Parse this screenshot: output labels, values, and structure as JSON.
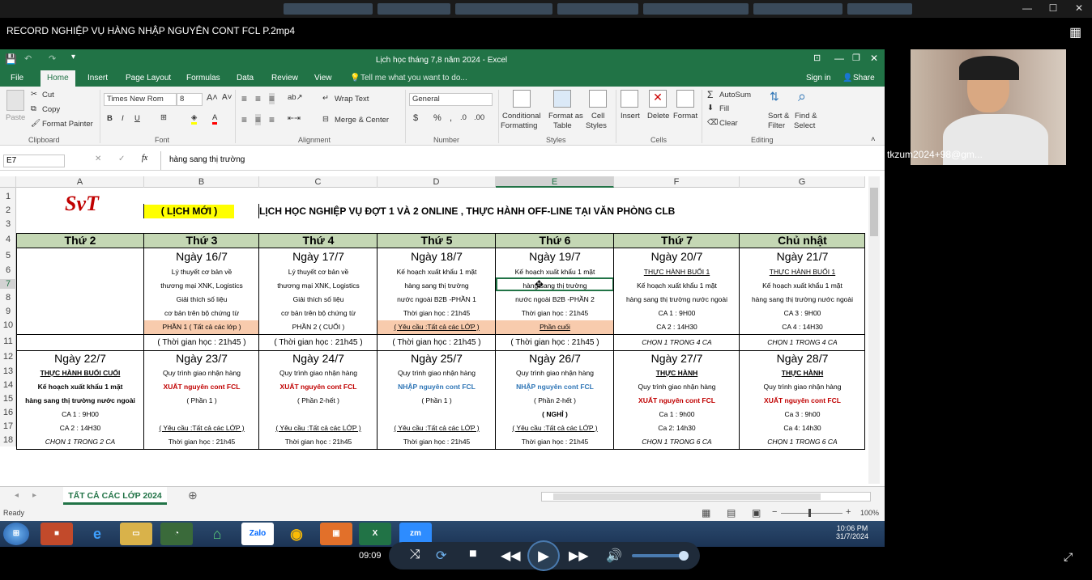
{
  "player": {
    "title": "RECORD NGHIỆP VỤ HÀNG NHẬP NGUYÊN CONT FCL P.2mp4",
    "time": "09:09"
  },
  "excel": {
    "title": "Lịch học tháng 7,8 năm  2024 - Excel",
    "tabs": [
      "File",
      "Home",
      "Insert",
      "Page Layout",
      "Formulas",
      "Data",
      "Review",
      "View"
    ],
    "tell_me": "Tell me what you want to do...",
    "sign_in": "Sign in",
    "share": "Share",
    "clipboard": {
      "paste": "Paste",
      "cut": "Cut",
      "copy": "Copy",
      "format_painter": "Format Painter",
      "label": "Clipboard"
    },
    "font": {
      "name": "Times New Rom",
      "size": "8",
      "label": "Font"
    },
    "alignment": {
      "wrap": "Wrap Text",
      "merge": "Merge & Center",
      "label": "Alignment"
    },
    "number": {
      "format": "General",
      "label": "Number"
    },
    "styles": {
      "conditional": "Conditional",
      "formatting": "Formatting",
      "format_as": "Format as",
      "table": "Table",
      "cell": "Cell",
      "cell_styles": "Styles",
      "label": "Styles"
    },
    "cells": {
      "insert": "Insert",
      "delete": "Delete",
      "format": "Format",
      "label": "Cells"
    },
    "editing": {
      "autosum": "AutoSum",
      "fill": "Fill",
      "clear": "Clear",
      "sort": "Sort &",
      "filter": "Filter",
      "find": "Find &",
      "select": "Select",
      "label": "Editing"
    },
    "name_box": "E7",
    "formula": "hàng sang thị trường",
    "columns": [
      "A",
      "B",
      "C",
      "D",
      "E",
      "F",
      "G"
    ],
    "rows": [
      "1",
      "2",
      "3",
      "4",
      "5",
      "6",
      "7",
      "8",
      "9",
      "10",
      "11",
      "12",
      "13",
      "14",
      "15",
      "16",
      "17",
      "18"
    ],
    "sheet_tab": "TẤT CẢ CÁC LỚP 2024",
    "status": "Ready",
    "zoom": "100%"
  },
  "sheet": {
    "logo": "SvT",
    "badge": "( LỊCH MỚI )",
    "heading": "LỊCH HỌC NGHIỆP VỤ  ĐỢT 1 VÀ 2  ONLINE ,  THỰC HÀNH  OFF-LINE TẠI  VĂN PHÒNG CLB",
    "days": [
      "Thứ 2",
      "Thứ 3",
      "Thứ 4",
      "Thứ 5",
      "Thứ 6",
      "Thứ 7",
      "Chủ nhật"
    ],
    "w1_dates": [
      "",
      "Ngày 16/7",
      "Ngày 17/7",
      "Ngày 18/7",
      "Ngày 19/7",
      "Ngày 20/7",
      "Ngày 21/7"
    ],
    "w1": [
      [
        "",
        "Lý thuyết cơ bản về",
        "Lý thuyết cơ bản về",
        "Kế hoạch xuất khẩu 1 mặt",
        "Kế hoạch xuất khẩu 1 mặt",
        "THỰC HÀNH  BUỔI 1",
        "THỰC HÀNH   BUỔI 1"
      ],
      [
        "",
        "thương mại XNK, Logistics",
        "thương mại XNK, Logistics",
        "hàng sang thị trường",
        "hàng sang thị trường",
        "Kế hoạch xuất khẩu 1 mặt",
        "Kế hoạch xuất khẩu 1 mặt"
      ],
      [
        "",
        "Giải thích số liệu",
        "Giải thích số liệu",
        "nước ngoài B2B -PHẦN 1",
        "nước ngoài B2B -PHẦN 2",
        "hàng sang thị trường nước ngoài",
        "hàng sang thị trường nước ngoài"
      ],
      [
        "",
        "cơ bản trên bộ chứng từ",
        "cơ bản trên bộ chứng từ",
        "Thời gian học : 21h45",
        "Thời gian học : 21h45",
        "CA 1 : 9H00",
        "CA 3 : 9H00"
      ],
      [
        "",
        "PHẦN 1 ( Tất cả các lớp )",
        "PHẦN 2 ( CUỐI )",
        "( Yêu cầu :Tất cả các LỚP )",
        "Phần cuối",
        "CA 2 : 14H30",
        "CA 4 : 14H30"
      ]
    ],
    "w1_foot": [
      "",
      "( Thời gian học : 21h45 )",
      "( Thời gian học : 21h45 )",
      "( Thời gian học : 21h45 )",
      "( Thời gian học : 21h45 )",
      "CHỌN 1 TRONG 4 CA",
      "CHỌN 1 TRONG 4 CA"
    ],
    "w2_dates": [
      "Ngày 22/7",
      "Ngày 23/7",
      "Ngày 24/7",
      "Ngày 25/7",
      "Ngày 26/7",
      "Ngày 27/7",
      "Ngày 28/7"
    ],
    "w2": [
      [
        "THỰC HÀNH BUỔI CUỐI",
        "Quy trình giao nhận hàng",
        "Quy trình giao nhận hàng",
        "Quy trình giao nhận hàng",
        "Quy trình giao nhận hàng",
        "THỰC HÀNH",
        "THỰC HÀNH"
      ],
      [
        "Kế hoạch xuất khẩu 1 mặt",
        "XUẤT nguyên cont FCL",
        "XUẤT nguyên cont FCL",
        "NHẬP nguyên cont FCL",
        "NHẬP nguyên cont FCL",
        "Quy trình giao nhận hàng",
        "Quy trình giao nhận hàng"
      ],
      [
        "hàng sang thị trường nước ngoài",
        "( Phần 1 )",
        "( Phần 2-hết )",
        "( Phần 1 )",
        "( Phần 2-hết )",
        "XUẤT nguyên cont FCL",
        "XUẤT nguyên cont FCL"
      ],
      [
        "CA 1 : 9H00",
        "",
        "",
        "",
        "( NGHỈ )",
        "Ca 1 : 9h00",
        "Ca 3 : 9h00"
      ],
      [
        "CA 2 : 14H30",
        "( Yêu cầu :Tất cả các LỚP )",
        "( Yêu cầu :Tất cả các LỚP )",
        "( Yêu cầu :Tất cả các LỚP )",
        "( Yêu cầu :Tất cả các LỚP )",
        "Ca 2: 14h30",
        "Ca 4: 14h30"
      ]
    ],
    "w2_foot": [
      "CHỌN  1 TRONG 2 CA",
      "Thời gian học : 21h45",
      "Thời gian học : 21h45",
      "Thời gian học : 21h45",
      "Thời gian học : 21h45",
      "CHỌN 1 TRONG 6 CA",
      "CHỌN 1 TRONG 6 CA"
    ]
  },
  "taskbar": {
    "time": "10:06 PM",
    "date": "31/7/2024"
  },
  "cam": {
    "name": "tkzum2024+98@gm..."
  },
  "colors": {
    "excel_green": "#217346",
    "header_fill": "#c4d7b4",
    "badge_yellow": "#ffff00",
    "pink_fill": "#f8cbad",
    "red_text": "#c00000",
    "blue_text": "#2e75b6"
  }
}
